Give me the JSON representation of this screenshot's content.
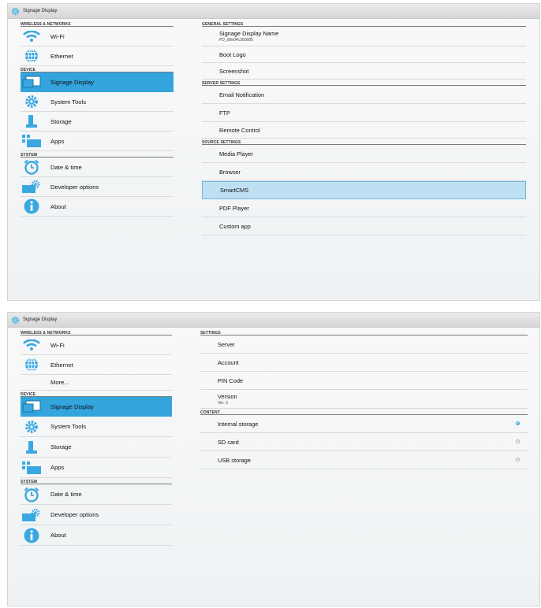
{
  "screen1": {
    "title": "Signage Display",
    "left": {
      "wireless_header": "WIRELESS & NETWORKS",
      "wifi": "Wi-Fi",
      "ethernet": "Ethernet",
      "device_header": "DEVICE",
      "signage_display": "Signage Display",
      "system_tools": "System Tools",
      "storage": "Storage",
      "apps": "Apps",
      "system_header": "SYSTEM",
      "date_time": "Date & time",
      "developer_options": "Developer options",
      "about": "About"
    },
    "right": {
      "general_header": "GENERAL SETTINGS",
      "signage_display_name": "Signage Display Name",
      "signage_display_name_value": "PD_00e04c360085",
      "boot_logo": "Boot Logo",
      "screenshot": "Screenshot",
      "server_header": "SERVER SETTINGS",
      "email_notification": "Email Notification",
      "ftp": "FTP",
      "remote_control": "Remote Control",
      "source_header": "SOURCE SETTINGS",
      "media_player": "Media Player",
      "browser": "Browser",
      "smartcms": "SmartCMS",
      "pdf_player": "PDF Player",
      "custom_app": "Custom app"
    }
  },
  "screen2": {
    "title": "Signage Display",
    "left": {
      "wireless_header": "WIRELESS & NETWORKS",
      "wifi": "Wi-Fi",
      "ethernet": "Ethernet",
      "more": "More...",
      "device_header": "DEVICE",
      "signage_display": "Signage Display",
      "system_tools": "System Tools",
      "storage": "Storage",
      "apps": "Apps",
      "system_header": "SYSTEM",
      "date_time": "Date & time",
      "developer_options": "Developer options",
      "about": "About"
    },
    "right": {
      "settings_header": "SETTINGS",
      "server": "Server",
      "account": "Account",
      "pin_code": "PIN Code",
      "version": "Version",
      "version_value": "Ver. 3",
      "content_header": "CONTENT",
      "internal_storage": "Internal storage",
      "sd_card": "SD card",
      "usb_storage": "USB storage",
      "selected_storage": "Internal storage"
    }
  },
  "colors": {
    "accent": "#33a4dc",
    "selected_row": "#bfe0f3"
  },
  "icons": [
    "gear-icon",
    "wifi-icon",
    "ethernet-globe-icon",
    "monitor-icon",
    "gear-icon",
    "storage-icon",
    "apps-icon",
    "clock-icon",
    "developer-icon",
    "info-icon"
  ]
}
